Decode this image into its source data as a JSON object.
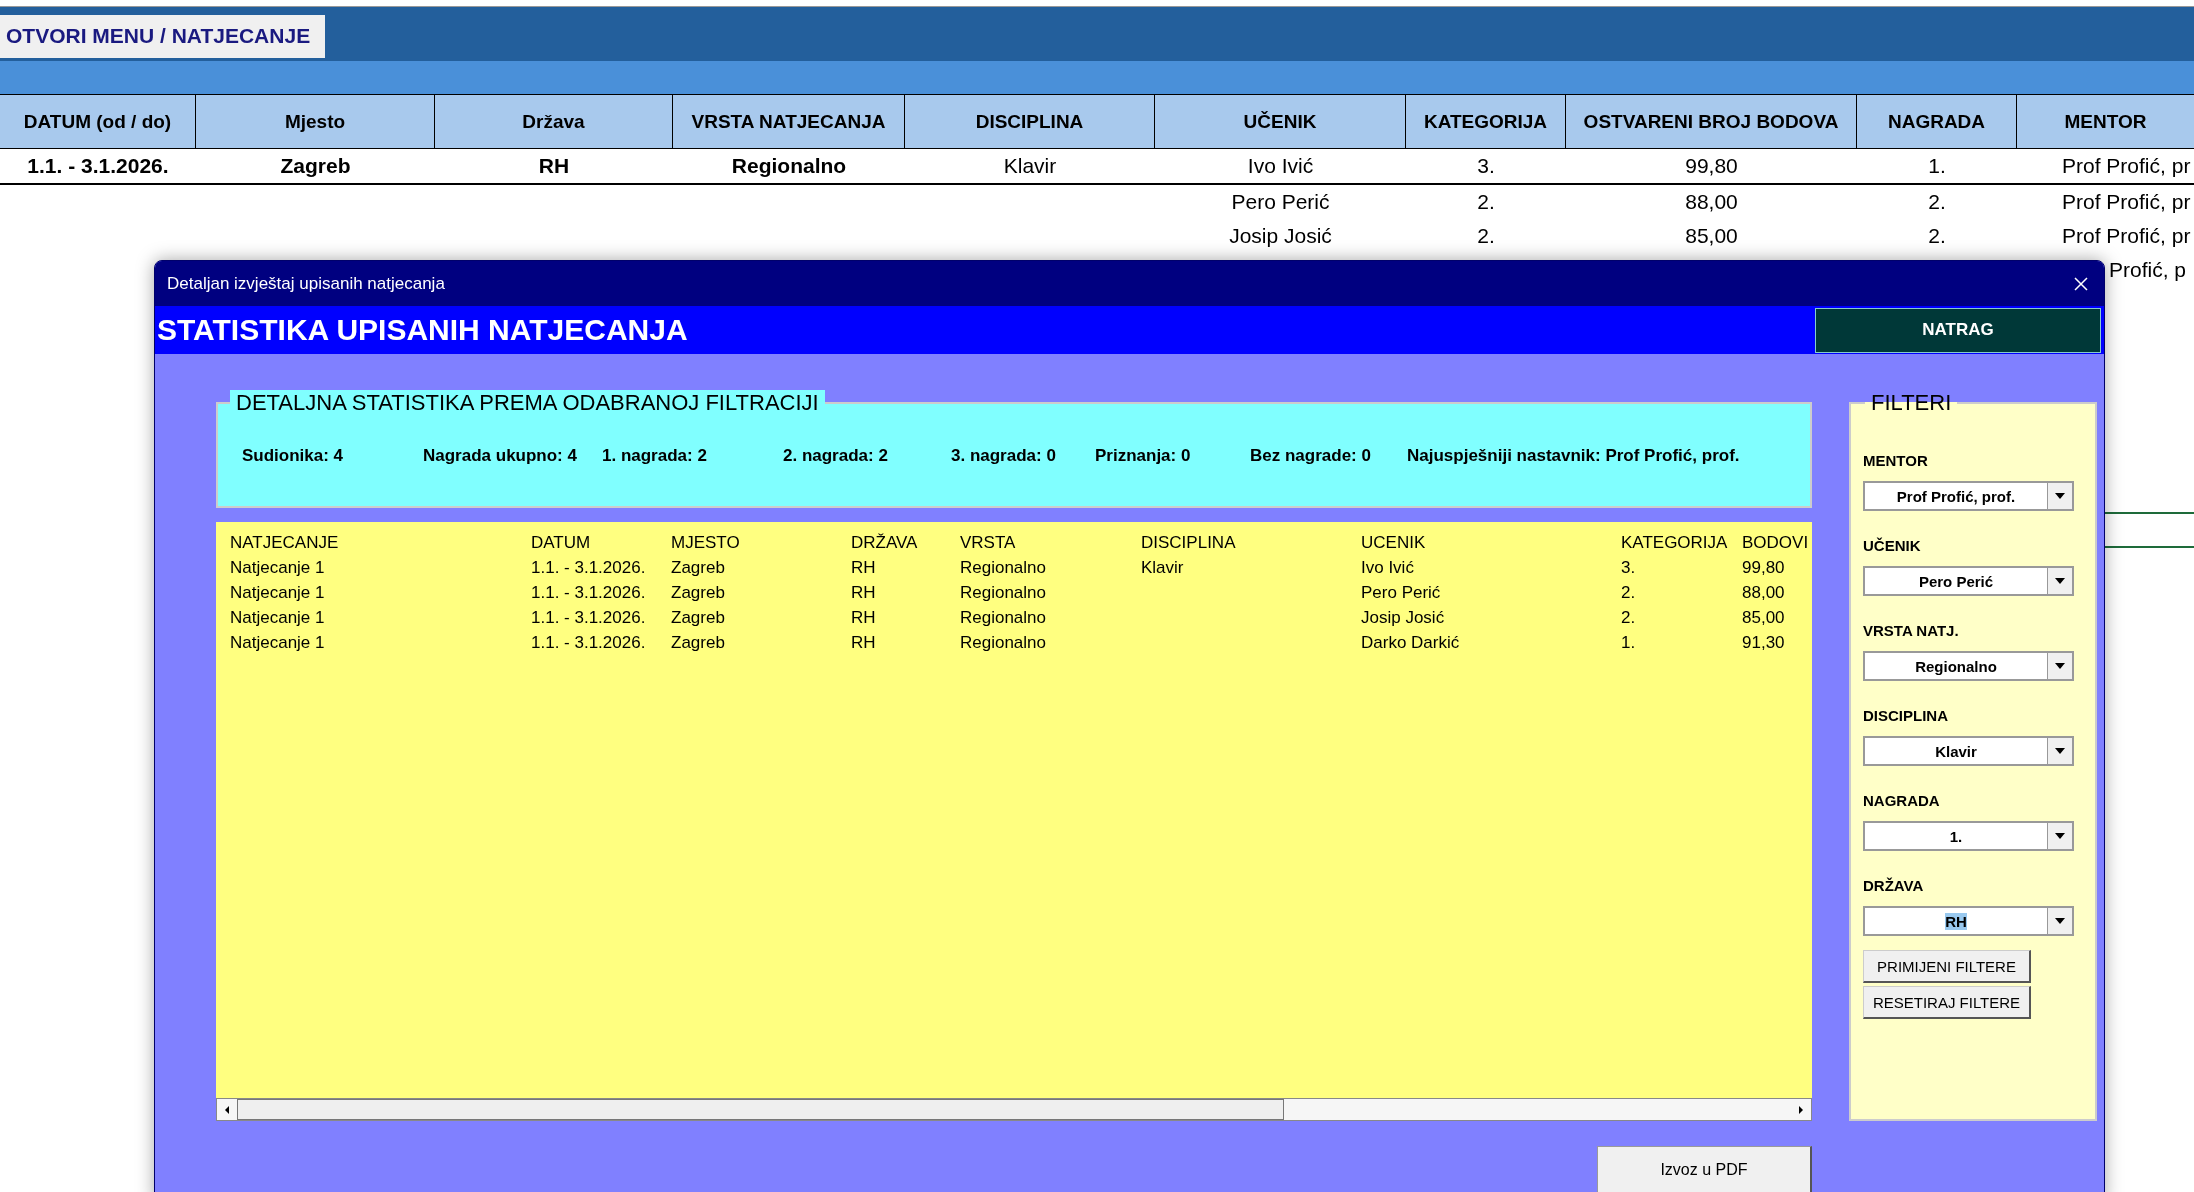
{
  "sheet": {
    "menu_button": "OTVORI MENU / NATJECANJE",
    "columns": [
      {
        "label": "DATUM (od / do)",
        "bold_values": true
      },
      {
        "label": "Mjesto",
        "bold_values": true
      },
      {
        "label": "Država",
        "bold_values": true
      },
      {
        "label": "VRSTA NATJECANJA",
        "bold_values": true
      },
      {
        "label": "DISCIPLINA",
        "bold_values": false
      },
      {
        "label": "UČENIK",
        "bold_values": false
      },
      {
        "label": "KATEGORIJA",
        "bold_values": false
      },
      {
        "label": "OSTVARENI BROJ BODOVA",
        "bold_values": false
      },
      {
        "label": "NAGRADA",
        "bold_values": false
      },
      {
        "label": "MENTOR",
        "bold_values": false
      }
    ],
    "rows": [
      {
        "cells": [
          "1.1. - 3.1.2026.",
          "Zagreb",
          "RH",
          "Regionalno",
          "Klavir",
          "Ivo Ivić",
          "3.",
          "99,80",
          "1.",
          "Prof Profić, pr"
        ]
      },
      {
        "cells": [
          null,
          null,
          null,
          null,
          null,
          "Pero Perić",
          "2.",
          "88,00",
          "2.",
          "Prof Profić, pr"
        ]
      },
      {
        "cells": [
          null,
          null,
          null,
          null,
          null,
          "Josip Josić",
          "2.",
          "85,00",
          "2.",
          "Prof Profić, pr"
        ]
      },
      {
        "cells": [
          null,
          null,
          null,
          null,
          null,
          null,
          null,
          null,
          null,
          "Profić, p"
        ]
      }
    ]
  },
  "dialog": {
    "title": "Detaljan izvještaj upisanih natjecanja",
    "heading": "STATISTIKA UPISANIH NATJECANJA",
    "back_button": "NATRAG",
    "stats_frame": {
      "legend": "DETALJNA STATISTIKA PREMA ODABRANOJ FILTRACIJI",
      "stats": [
        "Sudionika: 4",
        "Nagrada ukupno: 4",
        "1. nagrada: 2",
        "2. nagrada: 2",
        "3. nagrada: 0",
        "Priznanja: 0",
        "Bez nagrade: 0",
        "Najuspješniji nastavnik: Prof Profić, prof."
      ]
    },
    "list": {
      "columns": [
        "NATJECANJE",
        "DATUM",
        "MJESTO",
        "DRŽAVA",
        "VRSTA",
        "DISCIPLINA",
        "UCENIK",
        "KATEGORIJA",
        "BODOVI"
      ],
      "rows": [
        [
          "Natjecanje 1",
          "1.1. - 3.1.2026.",
          "Zagreb",
          "RH",
          "Regionalno",
          "Klavir",
          "Ivo Ivić",
          "3.",
          "99,80"
        ],
        [
          "Natjecanje 1",
          "1.1. - 3.1.2026.",
          "Zagreb",
          "RH",
          "Regionalno",
          null,
          "Pero Perić",
          "2.",
          "88,00"
        ],
        [
          "Natjecanje 1",
          "1.1. - 3.1.2026.",
          "Zagreb",
          "RH",
          "Regionalno",
          null,
          "Josip Josić",
          "2.",
          "85,00"
        ],
        [
          "Natjecanje 1",
          "1.1. - 3.1.2026.",
          "Zagreb",
          "RH",
          "Regionalno",
          null,
          "Darko Darkić",
          "1.",
          "91,30"
        ]
      ]
    },
    "filters": {
      "legend": "FILTERI",
      "fields": [
        {
          "label": "MENTOR",
          "value": "Prof Profić, prof.",
          "highlighted": false
        },
        {
          "label": "UČENIK",
          "value": "Pero Perić",
          "highlighted": false
        },
        {
          "label": "VRSTA NATJ.",
          "value": "Regionalno",
          "highlighted": false
        },
        {
          "label": "DISCIPLINA",
          "value": "Klavir",
          "highlighted": false
        },
        {
          "label": "NAGRADA",
          "value": "1.",
          "highlighted": false
        },
        {
          "label": "DRŽAVA",
          "value": "RH",
          "highlighted": true
        }
      ],
      "buttons": [
        "PRIMIJENI FILTERE",
        "RESETIRAJ FILTERE"
      ]
    },
    "export_button": "Izvoz u PDF"
  }
}
